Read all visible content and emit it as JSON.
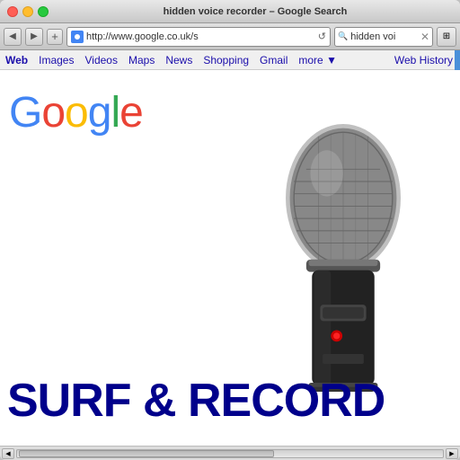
{
  "window": {
    "title": "hidden voice recorder – Google Search",
    "traffic_lights": {
      "close_color": "#ff5f56",
      "minimize_color": "#ffbd2e",
      "maximize_color": "#27c93f"
    }
  },
  "toolbar": {
    "back_label": "◀",
    "forward_label": "▶",
    "add_label": "+",
    "address": "http://www.google.co.uk/s",
    "reload_label": "↺",
    "search_query": "hidden voi",
    "page_btn_label": "⊞"
  },
  "nav_tabs": {
    "items": [
      {
        "label": "Web",
        "active": true
      },
      {
        "label": "Images"
      },
      {
        "label": "Videos"
      },
      {
        "label": "Maps"
      },
      {
        "label": "News"
      },
      {
        "label": "Shopping"
      },
      {
        "label": "Gmail"
      },
      {
        "label": "more ▼"
      }
    ],
    "web_history": "Web History"
  },
  "content": {
    "google_logo": "Google",
    "surf_record_text": "SURF & RECORD"
  },
  "scrollbar": {
    "left_arrow": "◀",
    "right_arrow": "▶"
  }
}
